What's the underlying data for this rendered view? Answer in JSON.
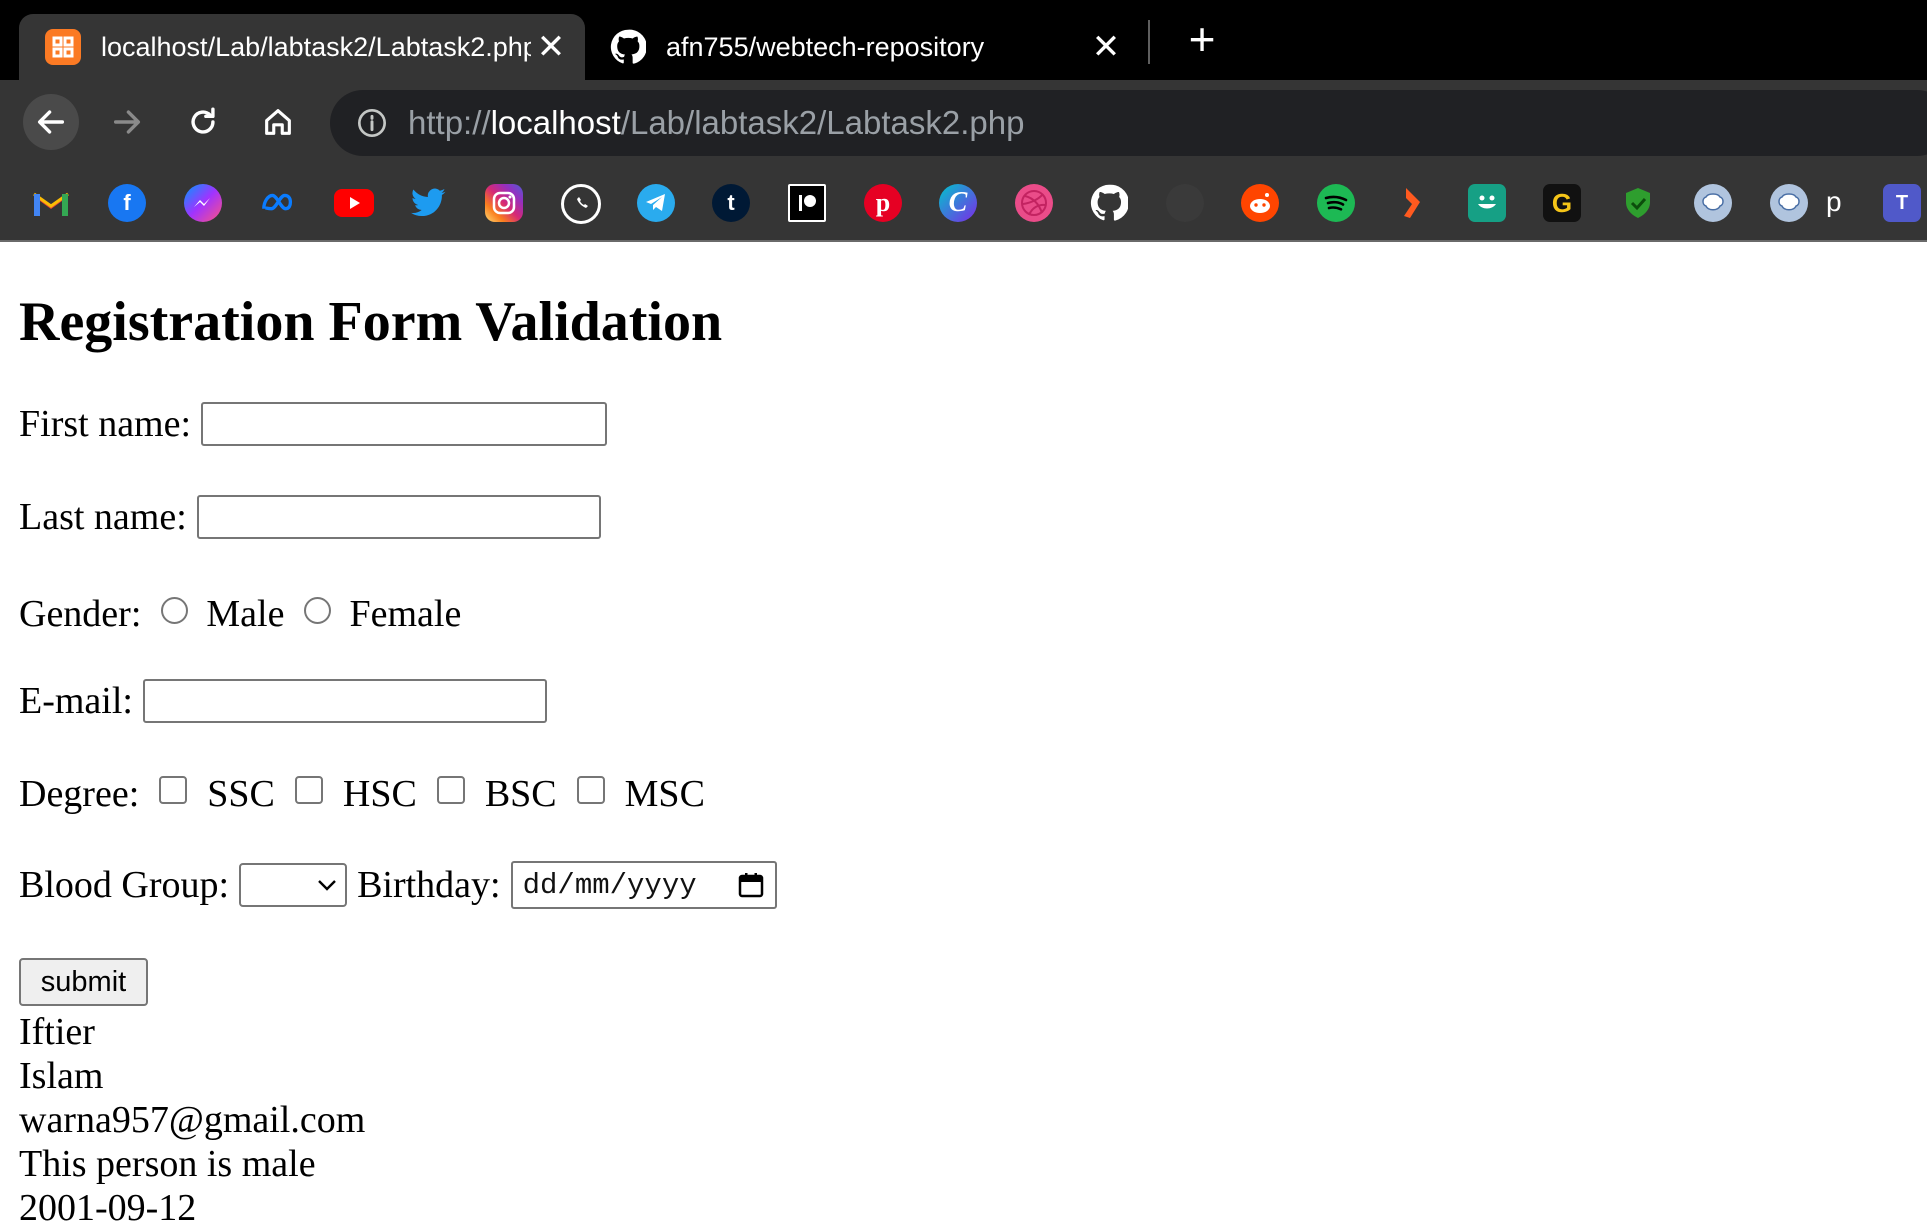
{
  "browser": {
    "tabs": [
      {
        "title": "localhost/Lab/labtask2/Labtask2.php",
        "favicon": "xampp-icon",
        "active": true,
        "close_label": "✕"
      },
      {
        "title": "afn755/webtech-repository",
        "favicon": "github-icon",
        "active": false,
        "close_label": "✕"
      }
    ],
    "new_tab_label": "+",
    "address": {
      "scheme": "http://",
      "host": "localhost",
      "path": "/Lab/labtask2/Labtask2.php"
    },
    "bookmarks": [
      {
        "name": "gmail-icon",
        "color": "#ea4335"
      },
      {
        "name": "facebook-icon",
        "color": "#1877f2"
      },
      {
        "name": "messenger-icon",
        "color": "#8a3ffc"
      },
      {
        "name": "meta-icon",
        "color": "#0668e1"
      },
      {
        "name": "youtube-icon",
        "color": "#ff0000"
      },
      {
        "name": "twitter-icon",
        "color": "#1d9bf0"
      },
      {
        "name": "instagram-icon",
        "color": "#e1306c"
      },
      {
        "name": "whatsapp-icon",
        "color": "#25d366"
      },
      {
        "name": "telegram-icon",
        "color": "#2aabee"
      },
      {
        "name": "tumblr-icon",
        "color": "#001935"
      },
      {
        "name": "patreon-icon",
        "color": "#000000"
      },
      {
        "name": "pinterest-icon",
        "color": "#e60023"
      },
      {
        "name": "canva-icon",
        "color": "#7d2ae8"
      },
      {
        "name": "dribbble-icon",
        "color": "#ea4c89"
      },
      {
        "name": "github-icon",
        "color": "#ffffff"
      },
      {
        "name": "blank-bookmark-icon",
        "color": "#3a3a3a"
      },
      {
        "name": "reddit-icon",
        "color": "#ff4500"
      },
      {
        "name": "spotify-icon",
        "color": "#1db954"
      },
      {
        "name": "orange-app-icon",
        "color": "#ff5a1f"
      },
      {
        "name": "smiley-app-icon",
        "color": "#16a085"
      },
      {
        "name": "g-app-icon",
        "color": "#111111"
      },
      {
        "name": "shield-icon",
        "color": "#2e9e2e"
      },
      {
        "name": "brain-icon",
        "color": "#b0c4de"
      },
      {
        "name": "brain-icon-2",
        "color": "#b0c4de"
      },
      {
        "name": "teams-icon",
        "color": "#5059c9"
      }
    ],
    "bookmark_text": "p"
  },
  "form": {
    "heading": "Registration Form Validation",
    "first_name_label": "First name:",
    "first_name_value": "",
    "last_name_label": "Last name:",
    "last_name_value": "",
    "gender_label": "Gender:",
    "gender_options": [
      "Male",
      "Female"
    ],
    "email_label": "E-mail:",
    "email_value": "",
    "degree_label": "Degree:",
    "degree_options": [
      "SSC",
      "HSC",
      "BSC",
      "MSC"
    ],
    "blood_group_label": "Blood Group:",
    "blood_group_value": "",
    "birthday_label": "Birthday:",
    "birthday_placeholder": "dd/mm/yyyy",
    "submit_label": "submit"
  },
  "output": [
    "Iftier",
    "Islam",
    "warna957@gmail.com",
    "This person is male",
    "2001-09-12"
  ]
}
